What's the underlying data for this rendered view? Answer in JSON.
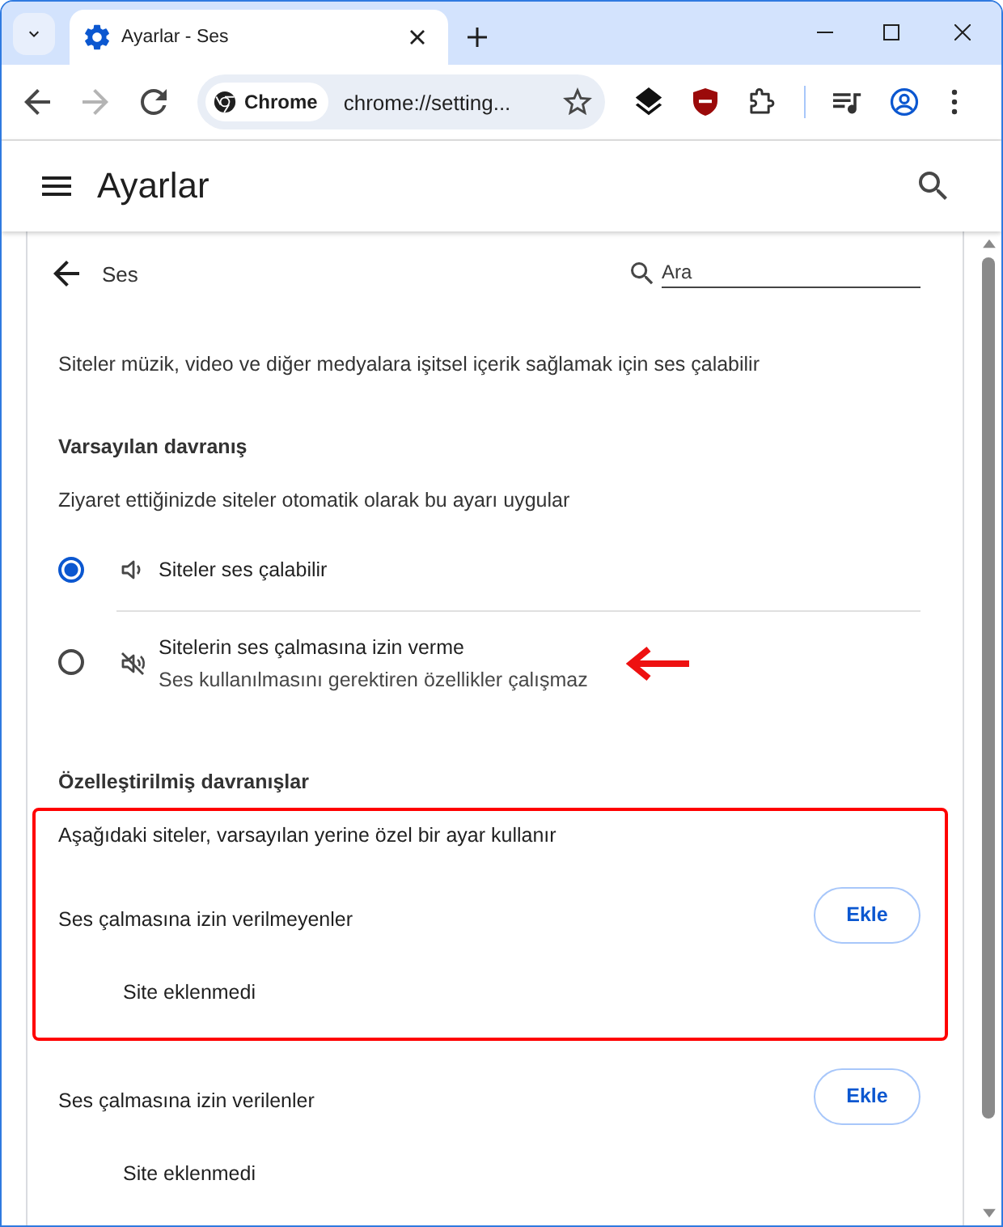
{
  "tabs": [
    {
      "title": "Ayarlar - Ses",
      "selected": true
    }
  ],
  "toolbar": {
    "navigation": [
      {
        "kind": "back",
        "disabled": false
      },
      {
        "kind": "forward",
        "disabled": true
      },
      {
        "kind": "reload",
        "disabled": false
      }
    ],
    "chip": "Chrome",
    "address": "chrome://setting..."
  },
  "header": {
    "title": "Ayarlar"
  },
  "subpage": {
    "title": "Ses",
    "search": {
      "placeholder": "Ara"
    }
  },
  "description": "Siteler müzik, video ve diğer medyalara işitsel içerik sağlamak için ses çalabilir",
  "default_behavior": {
    "heading": "Varsayılan davranış",
    "hint": "Ziyaret ettiğinizde siteler otomatik olarak bu ayarı uygular",
    "options": [
      {
        "kind": "allow",
        "label": "Siteler ses çalabilir",
        "selected": true,
        "pointer_arrow": false
      },
      {
        "kind": "block",
        "label": "Sitelerin ses çalmasına izin verme",
        "sublabel": "Ses kullanılmasını gerektiren özellikler çalışmaz",
        "selected": false,
        "pointer_arrow": true
      }
    ]
  },
  "custom_behaviors": {
    "heading": "Özelleştirilmiş davranışlar",
    "intro": "Aşağıdaki siteler, varsayılan yerine özel bir ayar kullanır",
    "highlighted": true,
    "lists": [
      {
        "title": "Ses çalmasına izin verilmeyenler",
        "button": "Ekle",
        "empty_text": "Site eklenmedi"
      },
      {
        "title": "Ses çalmasına izin verilenler",
        "button": "Ekle",
        "empty_text": "Site eklenmedi"
      }
    ]
  }
}
